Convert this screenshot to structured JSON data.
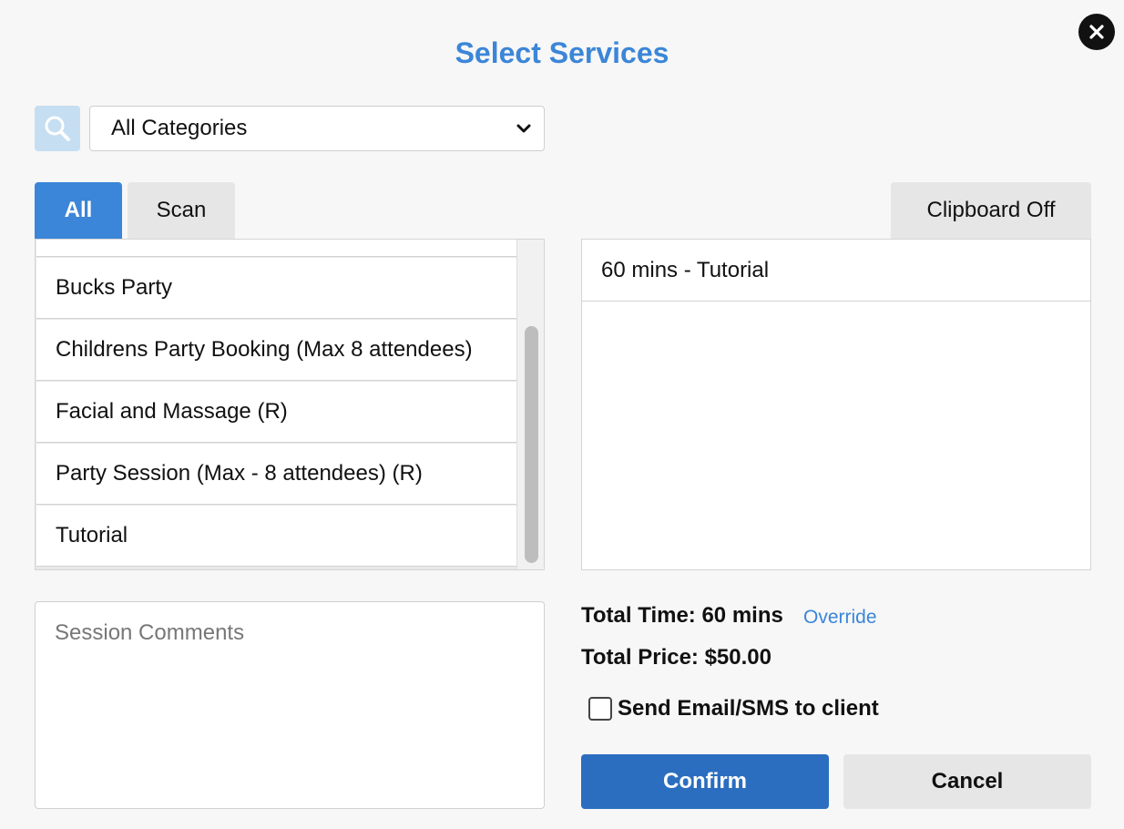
{
  "dialog": {
    "title": "Select Services"
  },
  "filters": {
    "category_selected": "All Categories"
  },
  "tabs": {
    "all_label": "All",
    "scan_label": "Scan",
    "clipboard_label": "Clipboard Off"
  },
  "services": [
    {
      "label": "Bucks Party"
    },
    {
      "label": "Childrens Party Booking (Max 8 attendees)"
    },
    {
      "label": "Facial and Massage (R)"
    },
    {
      "label": "Party Session (Max - 8 attendees) (R)"
    },
    {
      "label": "Tutorial"
    }
  ],
  "selected": [
    {
      "label": "60 mins - Tutorial"
    }
  ],
  "comments": {
    "placeholder": "Session Comments"
  },
  "summary": {
    "total_time": "Total Time: 60 mins",
    "override_label": "Override",
    "total_price": "Total Price: $50.00"
  },
  "notify": {
    "label": "Send Email/SMS to client",
    "checked": false
  },
  "actions": {
    "confirm_label": "Confirm",
    "cancel_label": "Cancel"
  },
  "colors": {
    "accent": "#3b86d8",
    "confirm": "#2b6ec0",
    "neutral_button": "#e6e6e6"
  }
}
